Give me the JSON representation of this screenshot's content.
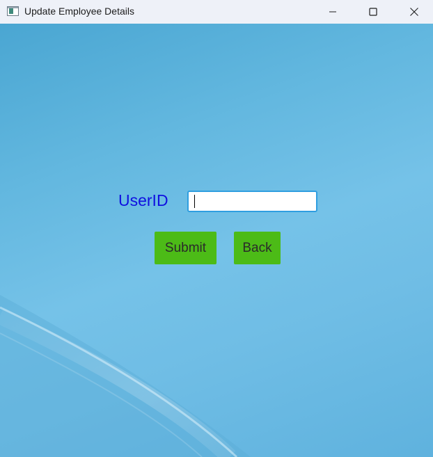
{
  "window": {
    "title": "Update Employee Details",
    "controls": {
      "minimize_icon": "minimize-icon",
      "maximize_icon": "maximize-icon",
      "close_icon": "close-icon"
    }
  },
  "form": {
    "userid_label": "UserID",
    "userid_value": "",
    "submit_label": "Submit",
    "back_label": "Back"
  },
  "colors": {
    "label": "#1010e0",
    "button": "#4cbb17",
    "input_focus_border": "#2f9ee0",
    "background": "#62b7df"
  }
}
